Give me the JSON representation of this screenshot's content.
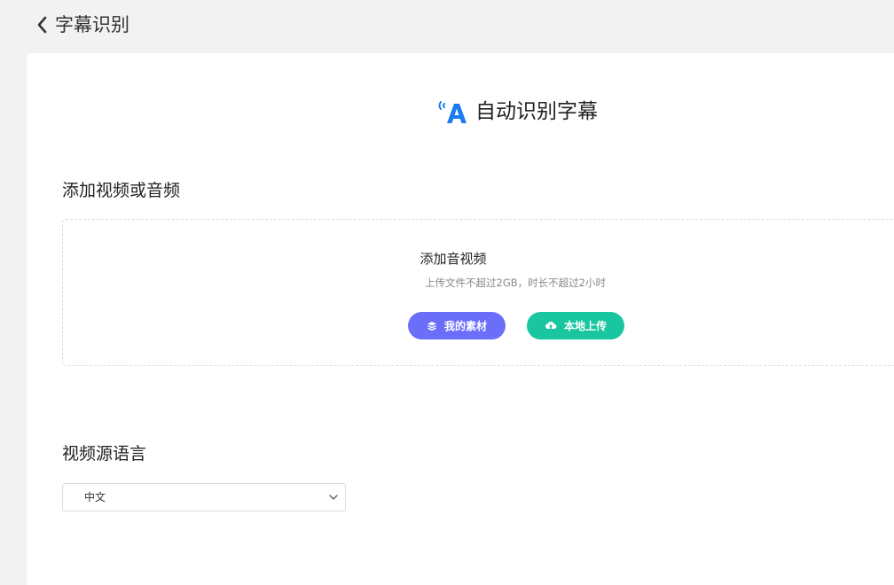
{
  "header": {
    "title": "字幕识别",
    "back_icon": "chevron-left-icon"
  },
  "hero": {
    "icon": "subtitle-recognition-icon",
    "title": "自动识别字幕",
    "accent_color": "#1a7cf0"
  },
  "upload_section": {
    "label": "添加视频或音频",
    "title": "添加音视频",
    "hint": "上传文件不超过2GB，时长不超过2小时",
    "buttons": [
      {
        "label": "我的素材",
        "icon": "layers-icon",
        "color": "#6b6ef9"
      },
      {
        "label": "本地上传",
        "icon": "cloud-upload-icon",
        "color": "#19c6a0"
      }
    ]
  },
  "language_section": {
    "label": "视频源语言",
    "selected": "中文",
    "icon": "chevron-down-icon"
  }
}
